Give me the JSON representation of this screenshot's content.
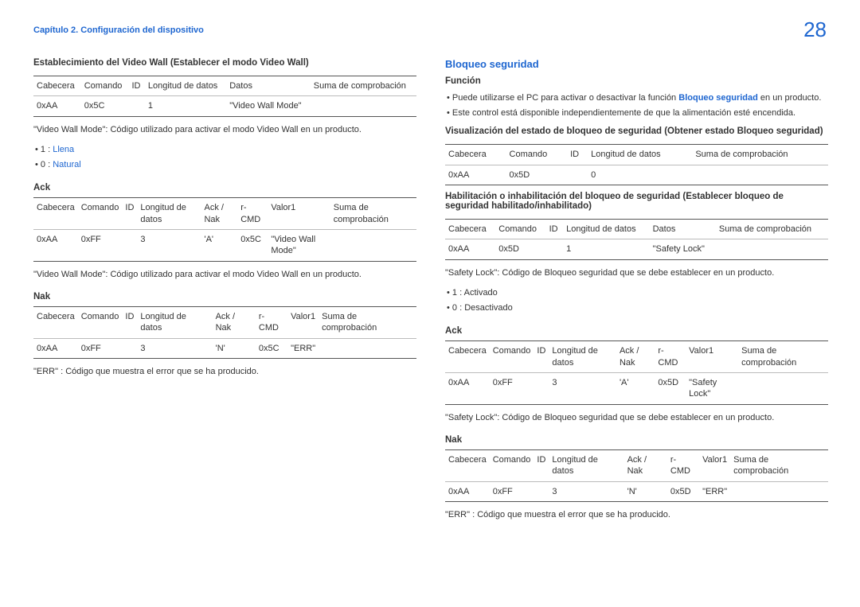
{
  "header": {
    "chapter": "Capítulo 2. Configuración del dispositivo",
    "page_number": "28"
  },
  "left": {
    "title1": "Establecimiento del Video Wall (Establecer el modo Video Wall)",
    "table1": {
      "head": [
        "Cabecera",
        "Comando",
        "ID",
        "Longitud de datos",
        "Datos",
        "Suma de comprobación"
      ],
      "row": [
        "0xAA",
        "0x5C",
        "",
        "1",
        "\"Video Wall Mode\"",
        ""
      ]
    },
    "note1": "\"Video Wall Mode\": Código utilizado para activar el modo Video Wall en un producto.",
    "bullets1": [
      {
        "prefix": "1 : ",
        "label": "Llena"
      },
      {
        "prefix": "0 : ",
        "label": "Natural"
      }
    ],
    "ack_title": "Ack",
    "table_ack": {
      "head": [
        "Cabecera",
        "Comando",
        "ID",
        "Longitud de datos",
        "Ack / Nak",
        "r-CMD",
        "Valor1",
        "Suma de comprobación"
      ],
      "row": [
        "0xAA",
        "0xFF",
        "",
        "3",
        "'A'",
        "0x5C",
        "\"Video Wall Mode\"",
        ""
      ]
    },
    "note2": "\"Video Wall Mode\": Código utilizado para activar el modo Video Wall en un producto.",
    "nak_title": "Nak",
    "table_nak": {
      "head": [
        "Cabecera",
        "Comando",
        "ID",
        "Longitud de datos",
        "Ack / Nak",
        "r-CMD",
        "Valor1",
        "Suma de comprobación"
      ],
      "row": [
        "0xAA",
        "0xFF",
        "",
        "3",
        "'N'",
        "0x5C",
        "\"ERR\"",
        ""
      ]
    },
    "note3": "\"ERR\" : Código que muestra el error que se ha producido."
  },
  "right": {
    "title_blue": "Bloqueo seguridad",
    "func_title": "Función",
    "func_b1_pre": "Puede utilizarse el PC para activar o desactivar la función ",
    "func_b1_bold": "Bloqueo seguridad",
    "func_b1_post": " en un producto.",
    "func_b2": "Este control está disponible independientemente de que la alimentación esté encendida.",
    "vis_title": "Visualización del estado de bloqueo de seguridad (Obtener estado Bloqueo seguridad)",
    "table_vis": {
      "head": [
        "Cabecera",
        "Comando",
        "ID",
        "Longitud de datos",
        "Suma de comprobación"
      ],
      "row": [
        "0xAA",
        "0x5D",
        "",
        "0",
        ""
      ]
    },
    "hab_title": "Habilitación o inhabilitación del bloqueo de seguridad (Establecer bloqueo de seguridad habilitado/inhabilitado)",
    "table_hab": {
      "head": [
        "Cabecera",
        "Comando",
        "ID",
        "Longitud de datos",
        "Datos",
        "Suma de comprobación"
      ],
      "row": [
        "0xAA",
        "0x5D",
        "",
        "1",
        "\"Safety Lock\"",
        ""
      ]
    },
    "note_safety": "\"Safety Lock\": Código de Bloqueo seguridad que se debe establecer en un producto.",
    "bullets_safety": [
      "1 : Activado",
      "0 : Desactivado"
    ],
    "ack_title": "Ack",
    "table_ack": {
      "head": [
        "Cabecera",
        "Comando",
        "ID",
        "Longitud de datos",
        "Ack / Nak",
        "r-CMD",
        "Valor1",
        "Suma de comprobación"
      ],
      "row": [
        "0xAA",
        "0xFF",
        "",
        "3",
        "'A'",
        "0x5D",
        "\"Safety Lock\"",
        ""
      ]
    },
    "note_ack": "\"Safety Lock\": Código de Bloqueo seguridad que se debe establecer en un producto.",
    "nak_title": "Nak",
    "table_nak": {
      "head": [
        "Cabecera",
        "Comando",
        "ID",
        "Longitud de datos",
        "Ack / Nak",
        "r-CMD",
        "Valor1",
        "Suma de comprobación"
      ],
      "row": [
        "0xAA",
        "0xFF",
        "",
        "3",
        "'N'",
        "0x5D",
        "\"ERR\"",
        ""
      ]
    },
    "note_nak": "\"ERR\" : Código que muestra el error que se ha producido."
  }
}
